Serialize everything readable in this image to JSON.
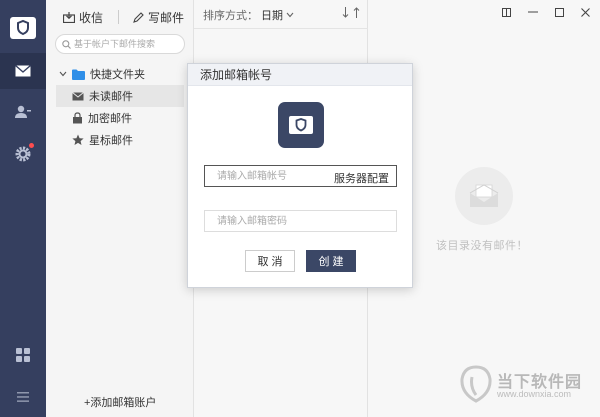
{
  "rail": {
    "items": [
      {
        "icon": "mail-icon"
      },
      {
        "icon": "contacts-icon"
      },
      {
        "icon": "settings-icon"
      },
      {
        "icon": "apps-grid-icon"
      },
      {
        "icon": "menu-icon"
      }
    ]
  },
  "toolbar": {
    "receive_label": "收信",
    "compose_label": "写邮件"
  },
  "search": {
    "placeholder": "基于帐户下邮件搜索"
  },
  "folders": {
    "quick_folder": "快捷文件夹",
    "items": [
      {
        "label": "未读邮件"
      },
      {
        "label": "加密邮件"
      },
      {
        "label": "星标邮件"
      }
    ],
    "add_account": "+添加邮箱账户"
  },
  "list": {
    "sort_label": "排序方式：",
    "sort_value": "日期"
  },
  "content": {
    "empty_text": "该目录没有邮件！"
  },
  "dialog": {
    "title": "添加邮箱帐号",
    "account_placeholder": "请输入邮箱帐号",
    "server_config": "服务器配置",
    "password_placeholder": "请输入邮箱密码",
    "cancel_label": "取 消",
    "create_label": "创 建"
  },
  "watermark": {
    "title": "当下软件园",
    "url": "www.downxia.com"
  },
  "colors": {
    "rail_bg": "#353f5f",
    "accent": "#3b4766",
    "folder_blue": "#2f8fe8",
    "badge_red": "#ff4d4f"
  }
}
